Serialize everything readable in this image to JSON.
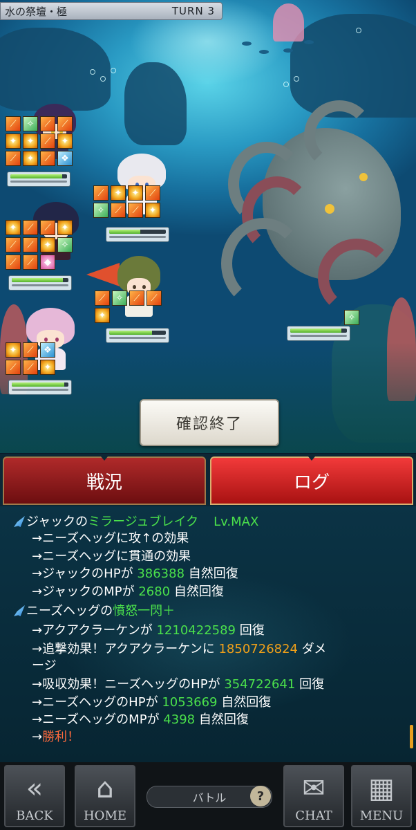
{
  "header": {
    "stage_name": "水の祭壇・極",
    "turn": "TURN 3"
  },
  "party": [
    {
      "name": "unit-top-left",
      "skills": [
        "fire",
        "green",
        "fire",
        "fire",
        "star",
        "star",
        "fire",
        "star",
        "fire",
        "star",
        "fire",
        "blue"
      ],
      "hp": 0.92
    },
    {
      "name": "unit-middle-left",
      "skills": [
        "star",
        "fire",
        "fire",
        "star",
        "fire",
        "fire",
        "star",
        "green",
        "fire",
        "fire",
        "pink"
      ],
      "hp": 0.9
    },
    {
      "name": "unit-bottom-left",
      "skills": [
        "star",
        "fire",
        "blue",
        "fire",
        "fire",
        "star"
      ],
      "hp": 0.93
    },
    {
      "name": "unit-top-right",
      "skills": [
        "fire",
        "star",
        "star",
        "fire",
        "green",
        "fire",
        "fire",
        "star"
      ],
      "hp": 0.55
    },
    {
      "name": "unit-bottom-right",
      "skills": [
        "fire",
        "green",
        "fire",
        "fire",
        "star"
      ],
      "hp": 0.75
    }
  ],
  "boss": {
    "hp": 0.9
  },
  "confirm_button": "確認終了",
  "tabs": {
    "status": "戦況",
    "log": "ログ"
  },
  "log": {
    "l1_actor": "ジャックの",
    "l1_skill": "ミラージュブレイク",
    "l1_level": "Lv.MAX",
    "l2": "→ニーズヘッグに攻↑の効果",
    "l3": "→ニーズヘッグに貫通の効果",
    "l4_pre": "→ジャックのHPが",
    "l4_num": "386388",
    "l4_post": "自然回復",
    "l5_pre": "→ジャックのMPが",
    "l5_num": "2680",
    "l5_post": "自然回復",
    "l6_actor": "ニーズヘッグの",
    "l6_skill": "憤怒一閃＋",
    "l7_pre": "→アクアクラーケンが",
    "l7_num": "1210422589",
    "l7_post": "回復",
    "l8_pre": "→追撃効果！アクアクラーケンに",
    "l8_num": "1850726824",
    "l8_post": "ダメ",
    "l8b": "ージ",
    "l9_pre": "→吸収効果！ニーズヘッグのHPが",
    "l9_num": "354722641",
    "l9_post": "回復",
    "l10_pre": "→ニーズヘッグのHPが",
    "l10_num": "1053669",
    "l10_post": "自然回復",
    "l11_pre": "→ニーズヘッグのMPが",
    "l11_num": "4398",
    "l11_post": "自然回復",
    "l12_pre": "→",
    "l12_word": "勝利！"
  },
  "nav": {
    "back": "BACK",
    "home": "HOME",
    "battle": "バトル",
    "help": "?",
    "chat": "CHAT",
    "menu": "MENU"
  },
  "colors": {
    "heal_number": "#4be14b",
    "damage_number": "#f0a019",
    "victory": "#ff6a3d",
    "tab_active": "#e02a2a"
  }
}
